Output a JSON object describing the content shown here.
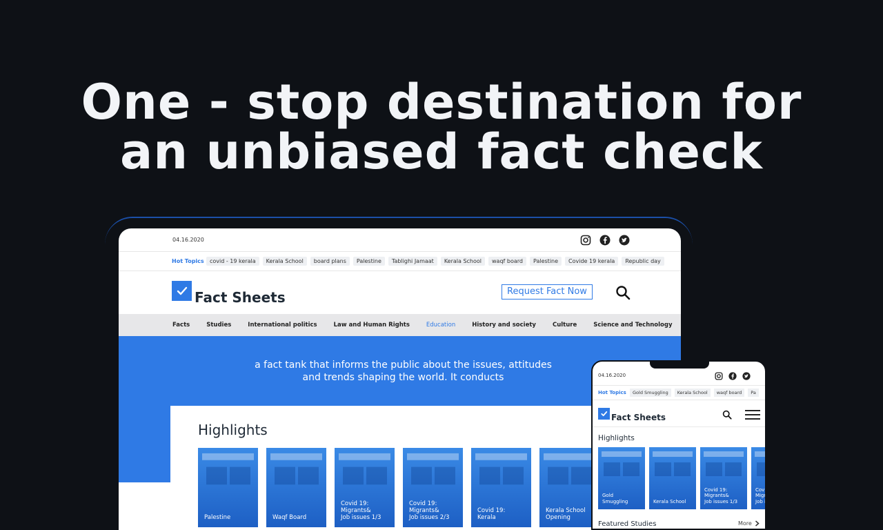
{
  "headline": {
    "line1": "One - stop destination for",
    "line2": "an unbiased fact check"
  },
  "desktop": {
    "date": "04.16.2020",
    "hot_topics_label": "Hot Topics",
    "hot_topics": [
      "covid - 19 kerala",
      "Kerala School",
      "board plans",
      "Palestine",
      "Tablighi Jamaat",
      "Kerala School",
      "waqf board",
      "Palestine",
      "Covide 19 kerala",
      "Republic day"
    ],
    "brand": "Fact Sheets",
    "request_button": "Request Fact Now",
    "nav": [
      "Facts",
      "Studies",
      "International politics",
      "Law and Human Rights",
      "Education",
      "History and society",
      "Culture",
      "Science and Technology"
    ],
    "nav_active": "Education",
    "tagline_line1": "a fact tank that informs the public about the issues, attitudes",
    "tagline_line2": "and trends shaping the world. It conducts",
    "highlights_title": "Highlights",
    "cards": [
      {
        "l1": "Palestine",
        "l2": "",
        "l3": ""
      },
      {
        "l1": "Waqf Board",
        "l2": "",
        "l3": ""
      },
      {
        "l1": "Covid 19:",
        "l2": "Migrants&",
        "l3": "Job issues 1/3"
      },
      {
        "l1": "Covid 19:",
        "l2": "Migrants&",
        "l3": "Job issues 2/3"
      },
      {
        "l1": "Covid 19:",
        "l2": "Kerala",
        "l3": ""
      },
      {
        "l1": "Kerala School",
        "l2": "Opening",
        "l3": ""
      }
    ]
  },
  "mobile": {
    "date": "04.16.2020",
    "hot_topics_label": "Hot Topics",
    "hot_topics": [
      "Gold Smuggling",
      "Kerala School",
      "waqf board",
      "Pa"
    ],
    "brand": "Fact Sheets",
    "highlights_title": "Highlights",
    "cards": [
      {
        "l1": "Gold",
        "l2": "Smuggling",
        "l3": ""
      },
      {
        "l1": "Kerala School",
        "l2": "",
        "l3": ""
      },
      {
        "l1": "Covid 19:",
        "l2": "Migrants&",
        "l3": "Job issues 1/3"
      },
      {
        "l1": "Covid",
        "l2": "Migra",
        "l3": "Job is"
      }
    ],
    "featured_title": "Featured Studies",
    "more_label": "More"
  },
  "colors": {
    "background": "#0e1116",
    "brand_blue": "#2f7ae5",
    "nav_bar": "#e7e7e9"
  },
  "icons": [
    "instagram-icon",
    "facebook-icon",
    "twitter-icon",
    "search-icon",
    "checkmark-icon",
    "hamburger-menu-icon",
    "chevron-right-icon"
  ]
}
